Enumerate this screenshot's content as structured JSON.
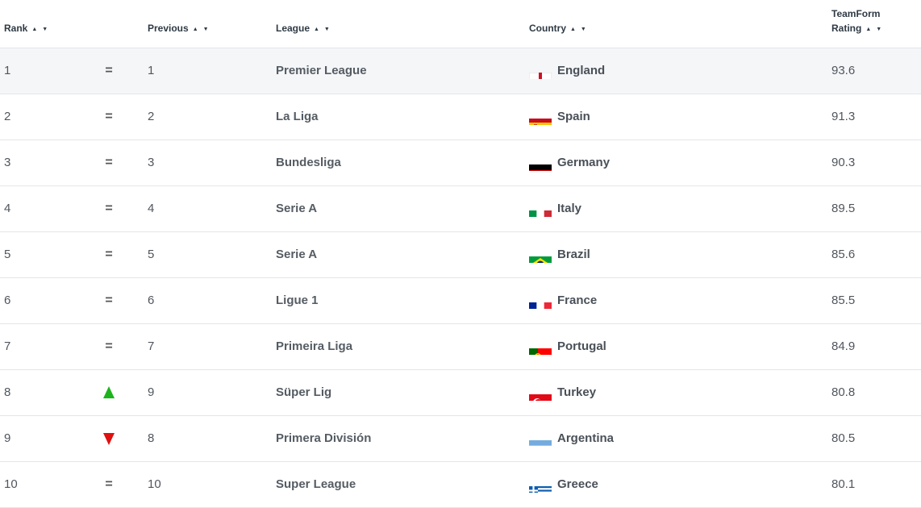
{
  "headers": {
    "rank": "Rank",
    "previous": "Previous",
    "league": "League",
    "country": "Country",
    "rating_line1": "TeamForm",
    "rating_line2": "Rating",
    "sort_glyph": "▲ ▼"
  },
  "rows": [
    {
      "rank": "1",
      "movement": "=",
      "move_type": "same",
      "previous": "1",
      "league": "Premier League",
      "country": "England",
      "flag": "england-flag",
      "rating": "93.6"
    },
    {
      "rank": "2",
      "movement": "=",
      "move_type": "same",
      "previous": "2",
      "league": "La Liga",
      "country": "Spain",
      "flag": "spain-flag",
      "rating": "91.3"
    },
    {
      "rank": "3",
      "movement": "=",
      "move_type": "same",
      "previous": "3",
      "league": "Bundesliga",
      "country": "Germany",
      "flag": "germany-flag",
      "rating": "90.3"
    },
    {
      "rank": "4",
      "movement": "=",
      "move_type": "same",
      "previous": "4",
      "league": "Serie A",
      "country": "Italy",
      "flag": "italy-flag",
      "rating": "89.5"
    },
    {
      "rank": "5",
      "movement": "=",
      "move_type": "same",
      "previous": "5",
      "league": "Serie A",
      "country": "Brazil",
      "flag": "brazil-flag",
      "rating": "85.6"
    },
    {
      "rank": "6",
      "movement": "=",
      "move_type": "same",
      "previous": "6",
      "league": "Ligue 1",
      "country": "France",
      "flag": "france-flag",
      "rating": "85.5"
    },
    {
      "rank": "7",
      "movement": "=",
      "move_type": "same",
      "previous": "7",
      "league": "Primeira Liga",
      "country": "Portugal",
      "flag": "portugal-flag",
      "rating": "84.9"
    },
    {
      "rank": "8",
      "movement": "",
      "move_type": "up",
      "previous": "9",
      "league": "Süper Lig",
      "country": "Turkey",
      "flag": "turkey-flag",
      "rating": "80.8"
    },
    {
      "rank": "9",
      "movement": "",
      "move_type": "down",
      "previous": "8",
      "league": "Primera División",
      "country": "Argentina",
      "flag": "argentina-flag",
      "rating": "80.5"
    },
    {
      "rank": "10",
      "movement": "=",
      "move_type": "same",
      "previous": "10",
      "league": "Super League",
      "country": "Greece",
      "flag": "greece-flag",
      "rating": "80.1"
    }
  ],
  "colors": {
    "up_arrow": "#1db31d",
    "down_arrow": "#e01010",
    "row_highlight": "#f5f6f8",
    "divider": "#e3e5e8"
  }
}
